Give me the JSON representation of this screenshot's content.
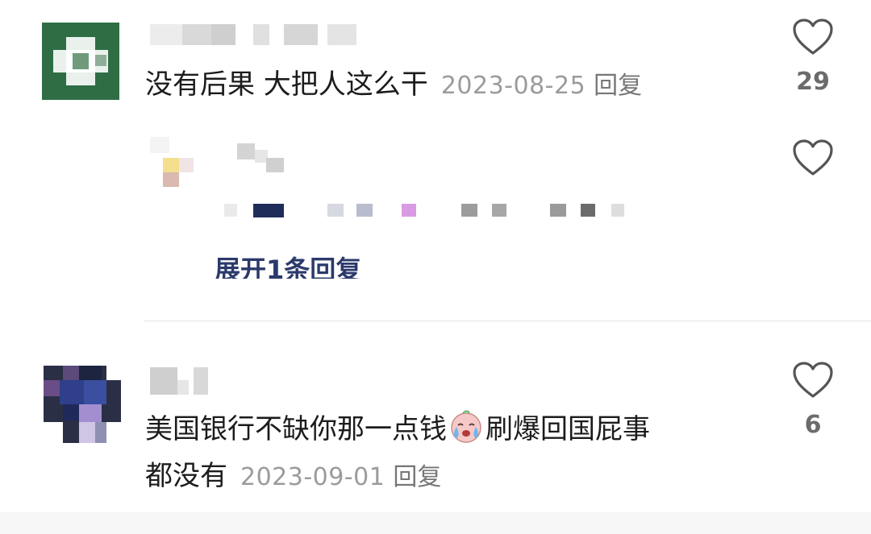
{
  "comments": [
    {
      "text": "没有后果 大把人这么干",
      "date": "2023-08-25",
      "reply_label": "回复",
      "likes": "29"
    },
    {
      "text_line1": "美国银行不缺你那一点钱",
      "emoji": "crying-face-emoji",
      "text_line1b": "刷爆回国屁事",
      "text_line2": "都没有",
      "date": "2023-09-01",
      "reply_label": "回复",
      "likes": "6"
    }
  ],
  "reply_thread": {
    "expand_label": "展开1条回复"
  },
  "icons": {
    "like": "heart-outline-icon"
  },
  "colors": {
    "text": "#1c1c1c",
    "meta": "#9b9b9b",
    "expand_link": "#2b3a6b"
  }
}
